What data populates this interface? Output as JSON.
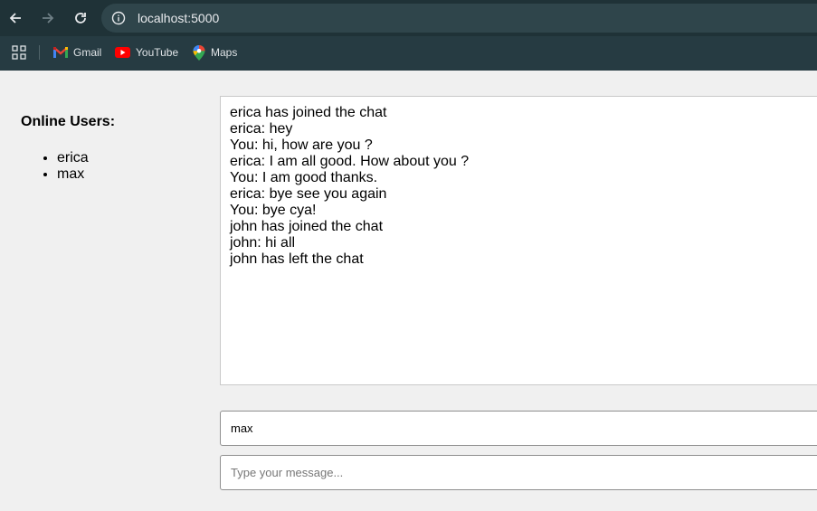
{
  "browser": {
    "url": "localhost:5000",
    "bookmarks": [
      {
        "label": "Gmail",
        "icon": "gmail-icon"
      },
      {
        "label": "YouTube",
        "icon": "youtube-icon"
      },
      {
        "label": "Maps",
        "icon": "maps-icon"
      }
    ]
  },
  "sidebar": {
    "title": "Online Users:",
    "users": [
      "erica",
      "max"
    ]
  },
  "chat": {
    "messages": [
      "erica has joined the chat",
      "erica: hey",
      "You: hi, how are you ?",
      "erica: I am all good. How about you ?",
      "You: I am good thanks.",
      "erica: bye see you again",
      "You: bye cya!",
      "john has joined the chat",
      "john: hi all",
      "john has left the chat"
    ]
  },
  "form": {
    "username_value": "max",
    "message_placeholder": "Type your message..."
  },
  "colors": {
    "chrome_bg": "#263b42",
    "toolbar_bg": "#1f3237",
    "page_bg": "#f0f0f0"
  }
}
